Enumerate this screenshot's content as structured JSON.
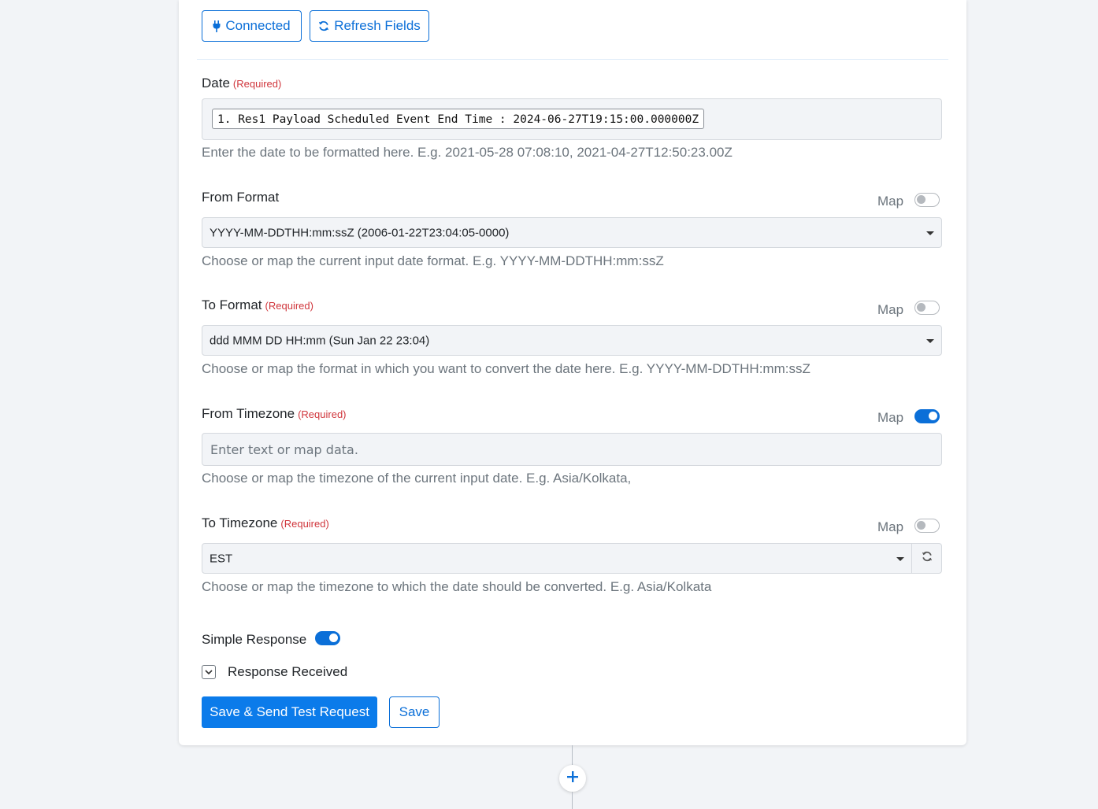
{
  "toolbar": {
    "connected_label": "Connected",
    "refresh_fields_label": "Refresh Fields"
  },
  "required_text": "(Required)",
  "fields": {
    "date": {
      "label": "Date",
      "chip_value": "1. Res1 Payload Scheduled Event End Time : 2024-06-27T19:15:00.000000Z",
      "help": "Enter the date to be formatted here. E.g. 2021-05-28 07:08:10, 2021-04-27T12:50:23.00Z"
    },
    "from_format": {
      "label": "From Format",
      "map_label": "Map",
      "map_enabled": false,
      "selected": "YYYY-MM-DDTHH:mm:ssZ (2006-01-22T23:04:05-0000)",
      "help": "Choose or map the current input date format. E.g. YYYY-MM-DDTHH:mm:ssZ"
    },
    "to_format": {
      "label": "To Format",
      "map_label": "Map",
      "map_enabled": false,
      "selected": "ddd MMM DD HH:mm (Sun Jan 22 23:04)",
      "help": "Choose or map the format in which you want to convert the date here. E.g. YYYY-MM-DDTHH:mm:ssZ"
    },
    "from_timezone": {
      "label": "From Timezone",
      "map_label": "Map",
      "map_enabled": true,
      "placeholder": "Enter text or map data.",
      "help": "Choose or map the timezone of the current input date. E.g. Asia/Kolkata,"
    },
    "to_timezone": {
      "label": "To Timezone",
      "map_label": "Map",
      "map_enabled": false,
      "selected": "EST",
      "help": "Choose or map the timezone to which the date should be converted. E.g. Asia/Kolkata"
    }
  },
  "simple_response": {
    "label": "Simple Response",
    "enabled": true
  },
  "response_received": {
    "label": "Response Received"
  },
  "actions": {
    "save_send_label": "Save & Send Test Request",
    "save_label": "Save"
  },
  "colors": {
    "accent": "#0b6fd8",
    "required": "#d0363c",
    "help_text": "#6c757d",
    "field_bg": "#f2f4f7"
  }
}
